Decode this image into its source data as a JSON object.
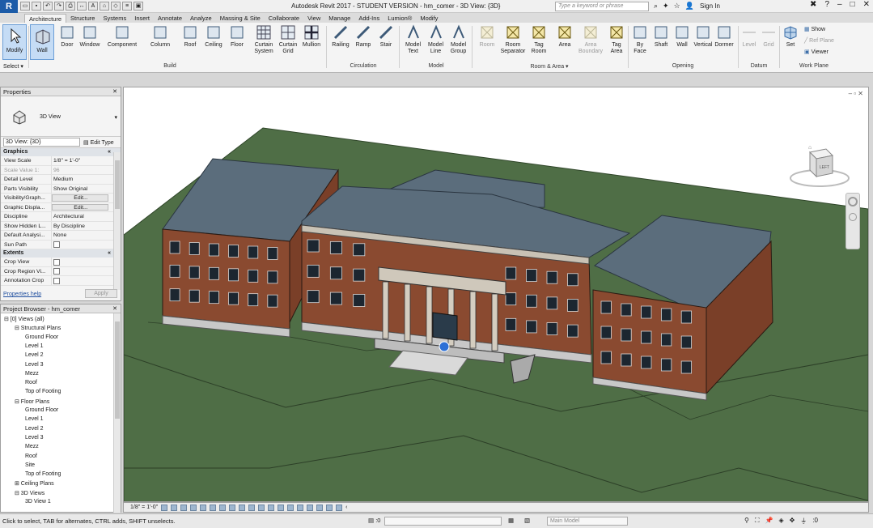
{
  "app": {
    "title": "Autodesk Revit 2017 - STUDENT VERSION -    hm_comer - 3D View: {3D}",
    "logo": "R",
    "search_placeholder": "Type a keyword or phrase",
    "signin": "Sign In"
  },
  "tabs": [
    "Architecture",
    "Structure",
    "Systems",
    "Insert",
    "Annotate",
    "Analyze",
    "Massing & Site",
    "Collaborate",
    "View",
    "Manage",
    "Add-Ins",
    "Lumion®",
    "Modify"
  ],
  "ribbon": {
    "modify": "Modify",
    "select": "Select ▾",
    "wall": "Wall",
    "build": [
      {
        "label": "Door",
        "name": "door-button"
      },
      {
        "label": "Window",
        "name": "window-button"
      },
      {
        "label": "Component",
        "name": "component-button"
      },
      {
        "label": "Column",
        "name": "column-button"
      },
      {
        "label": "Roof",
        "name": "roof-button"
      },
      {
        "label": "Ceiling",
        "name": "ceiling-button"
      },
      {
        "label": "Floor",
        "name": "floor-button"
      }
    ],
    "curtain_system": "Curtain\nSystem",
    "curtain_grid": "Curtain\nGrid",
    "mullion": "Mullion",
    "circulation": [
      "Railing",
      "Ramp",
      "Stair"
    ],
    "model": [
      "Model\nText",
      "Model\nLine",
      "Model\nGroup"
    ],
    "room_area": [
      {
        "label": "Room",
        "dim": true
      },
      {
        "label": "Room\nSeparator",
        "dim": false
      },
      {
        "label": "Tag\nRoom",
        "dim": false
      },
      {
        "label": "Area",
        "dim": false
      },
      {
        "label": "Area\nBoundary",
        "dim": true
      },
      {
        "label": "Tag\nArea",
        "dim": false
      }
    ],
    "opening": [
      "By\nFace",
      "Shaft",
      "Wall",
      "Vertical",
      "Dormer"
    ],
    "datum": [
      "Level",
      "Grid"
    ],
    "set": "Set",
    "show": "Show",
    "ref_plane": "Ref Plane",
    "viewer": "Viewer",
    "groups": [
      "Build",
      "Circulation",
      "Model",
      "Room & Area ▾",
      "Opening",
      "Datum",
      "Work Plane"
    ]
  },
  "properties": {
    "title": "Properties",
    "type_name": "3D View",
    "instance": "3D View: {3D}",
    "edit_type": "Edit Type",
    "graphics_header": "Graphics",
    "rows": [
      {
        "k": "View Scale",
        "v": "1/8\" = 1'-0\"",
        "kind": "text"
      },
      {
        "k": "Scale Value    1:",
        "v": "96",
        "kind": "gray"
      },
      {
        "k": "Detail Level",
        "v": "Medium",
        "kind": "text"
      },
      {
        "k": "Parts Visibility",
        "v": "Show Original",
        "kind": "text"
      },
      {
        "k": "Visibility/Graph...",
        "v": "Edit...",
        "kind": "btn"
      },
      {
        "k": "Graphic Displa...",
        "v": "Edit...",
        "kind": "btn"
      },
      {
        "k": "Discipline",
        "v": "Architectural",
        "kind": "text"
      },
      {
        "k": "Show Hidden L...",
        "v": "By Discipline",
        "kind": "text"
      },
      {
        "k": "Default Analysi...",
        "v": "None",
        "kind": "text"
      },
      {
        "k": "Sun Path",
        "v": "",
        "kind": "check"
      }
    ],
    "extents_header": "Extents",
    "extents": [
      "Crop View",
      "Crop Region Vi...",
      "Annotation Crop"
    ],
    "help": "Properties help",
    "apply": "Apply"
  },
  "browser": {
    "title": "Project Browser - hm_comer",
    "items": [
      {
        "t": "⊟ [0] Views (all)",
        "l": 0
      },
      {
        "t": "⊟ Structural Plans",
        "l": 1
      },
      {
        "t": "Ground Floor",
        "l": 2
      },
      {
        "t": "Level 1",
        "l": 2
      },
      {
        "t": "Level 2",
        "l": 2
      },
      {
        "t": "Level 3",
        "l": 2
      },
      {
        "t": "Mezz",
        "l": 2
      },
      {
        "t": "Roof",
        "l": 2
      },
      {
        "t": "Top of Footing",
        "l": 2
      },
      {
        "t": "⊟ Floor Plans",
        "l": 1
      },
      {
        "t": "Ground Floor",
        "l": 2
      },
      {
        "t": "Level 1",
        "l": 2
      },
      {
        "t": "Level 2",
        "l": 2
      },
      {
        "t": "Level 3",
        "l": 2
      },
      {
        "t": "Mezz",
        "l": 2
      },
      {
        "t": "Roof",
        "l": 2
      },
      {
        "t": "Site",
        "l": 2
      },
      {
        "t": "Top of Footing",
        "l": 2
      },
      {
        "t": "⊞ Ceiling Plans",
        "l": 1
      },
      {
        "t": "⊟ 3D Views",
        "l": 1
      },
      {
        "t": "3D View 1",
        "l": 2
      }
    ]
  },
  "viewbar": {
    "scale": "1/8\" = 1'-0\""
  },
  "viewcube": {
    "face": "LEFT"
  },
  "status": {
    "text": "Click to select, TAB for alternates, CTRL adds, SHIFT unselects.",
    "model": "Main Model",
    "zero": ":0"
  },
  "colors": {
    "grass": "#4f6e46",
    "brick": "#8a4a30",
    "roof": "#5b6d7c",
    "selected": "#c5dcf5"
  }
}
